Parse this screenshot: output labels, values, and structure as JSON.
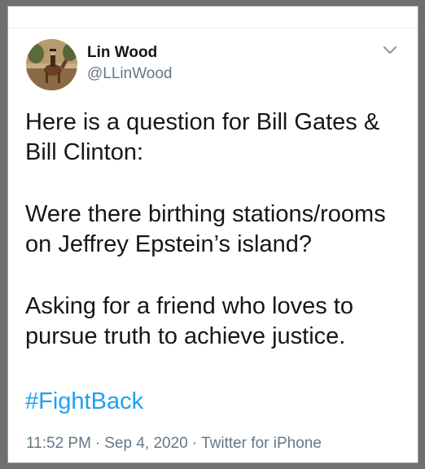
{
  "tweet": {
    "author_name": "Lin Wood",
    "author_handle": "@LLinWood",
    "paragraphs": [
      "Here is a question for Bill Gates & Bill Clinton:",
      "Were there birthing stations/rooms on Jeffrey Epstein’s island?",
      "Asking for a friend who loves to pursue truth to achieve justice."
    ],
    "hashtag": "#FightBack",
    "time": "11:52 PM",
    "separator": "·",
    "date": "Sep 4, 2020",
    "source": "Twitter for iPhone"
  },
  "icons": {
    "avatar": "avatar-horse-rider-image",
    "menu": "chevron-down-icon"
  },
  "colors": {
    "text": "#14171a",
    "secondary": "#657786",
    "link": "#1da1f2",
    "border": "#e6ecf0"
  }
}
